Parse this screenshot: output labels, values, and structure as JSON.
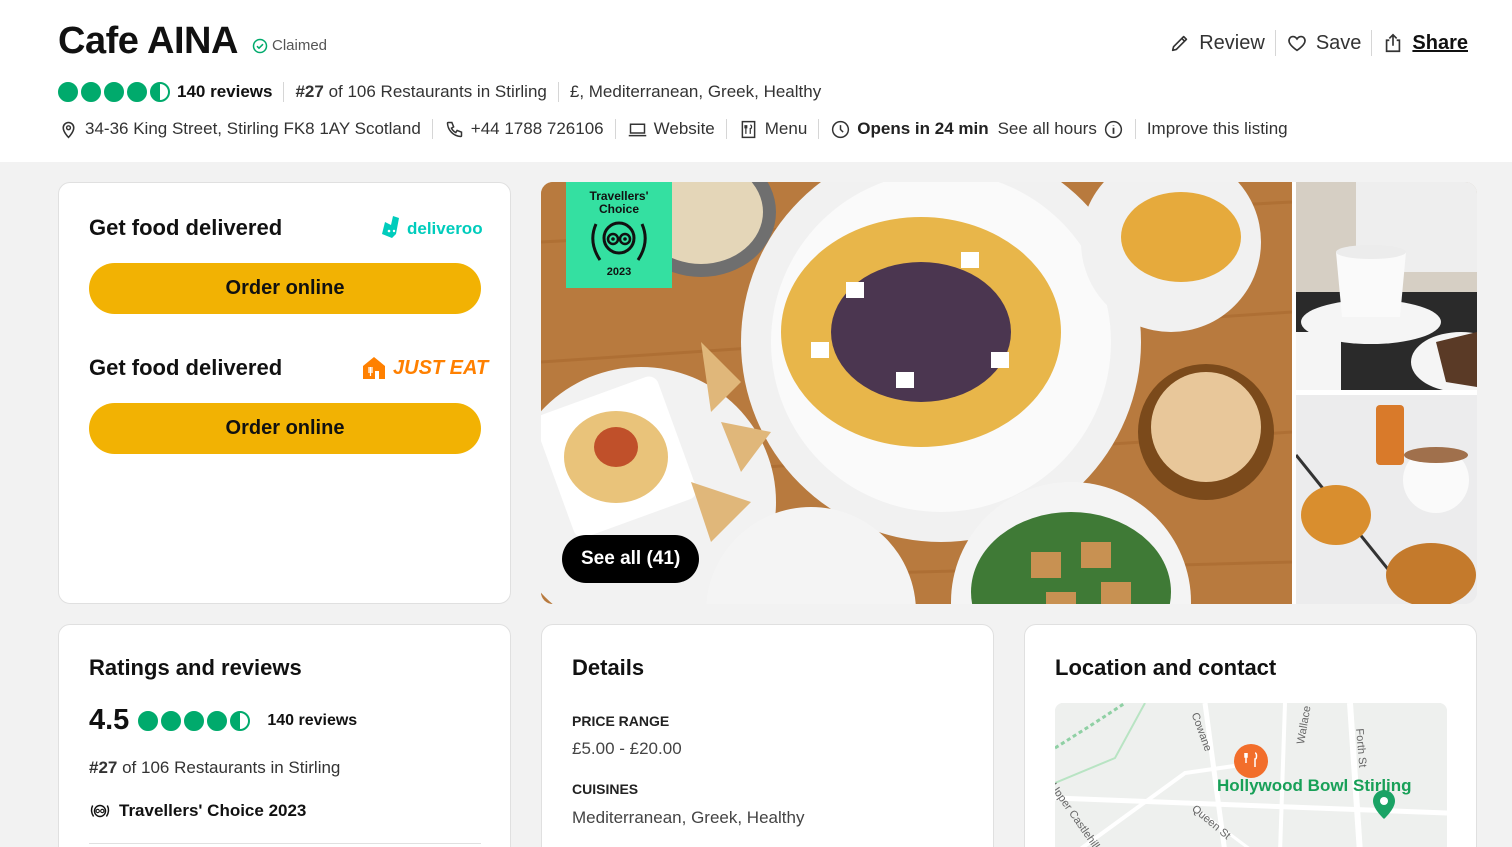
{
  "header": {
    "title": "Cafe AINA",
    "claimed": "Claimed",
    "actions": {
      "review": "Review",
      "save": "Save",
      "share": "Share"
    },
    "rating_bubbles": 4.5,
    "reviews": "140 reviews",
    "rank_prefix": "#27",
    "rank_rest": " of 106 Restaurants in Stirling",
    "cuisine": "£, Mediterranean, Greek, Healthy",
    "address": "34-36 King Street, Stirling FK8 1AY Scotland",
    "phone": "+44 1788 726106",
    "website": "Website",
    "menu": "Menu",
    "opens": "Opens in 24 min",
    "hours": "See all hours",
    "improve": "Improve this listing"
  },
  "delivery": {
    "title1": "Get food delivered",
    "brand1": "deliveroo",
    "button1": "Order online",
    "title2": "Get food delivered",
    "brand2": "JUST EAT",
    "button2": "Order online"
  },
  "gallery": {
    "badge_line1": "Travellers'",
    "badge_line2": "Choice",
    "badge_year": "2023",
    "see_all": "See all (41)"
  },
  "ratings": {
    "heading": "Ratings and reviews",
    "score": "4.5",
    "reviews": "140 reviews",
    "rank_prefix": "#27",
    "rank_rest": " of 106 Restaurants in Stirling",
    "travellers_choice": "Travellers' Choice 2023"
  },
  "details": {
    "heading": "Details",
    "price_label": "PRICE RANGE",
    "price_value": "£5.00 - £20.00",
    "cuisines_label": "CUISINES",
    "cuisines_value": "Mediterranean, Greek, Healthy"
  },
  "location": {
    "heading": "Location and contact",
    "map_label": "Hollywood Bowl Stirling",
    "streets": [
      "Cowane",
      "Wallace St",
      "Forth St",
      "Queen St",
      "Upper Castlehill"
    ]
  },
  "colors": {
    "accent_green": "#00aa6c",
    "button_yellow": "#f2b203",
    "deliveroo": "#00ccbc",
    "just_eat": "#ff8000"
  }
}
